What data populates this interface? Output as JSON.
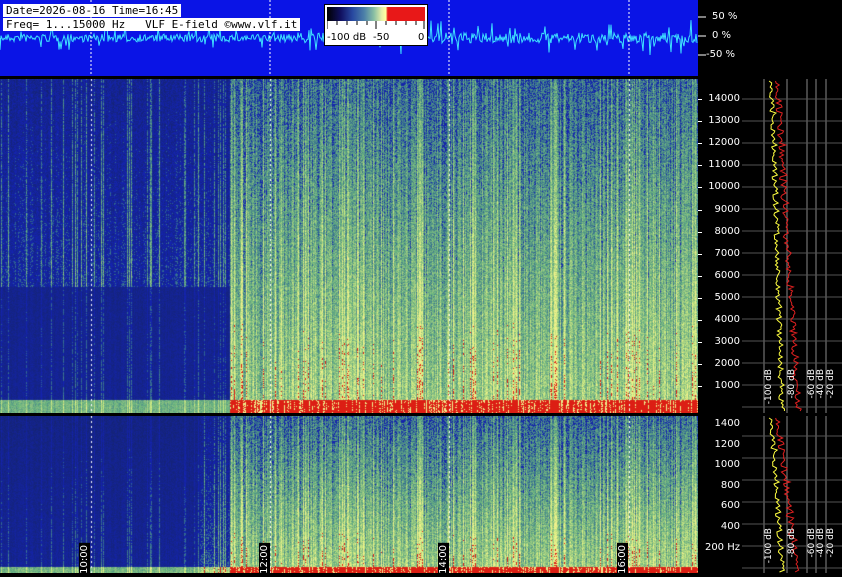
{
  "header": {
    "line1": "Date=2026-08-16 Time=16:45",
    "line2": "Freq= 1...15000 Hz   VLF E-field ©www.vlf.it"
  },
  "colorbar": {
    "labels": [
      "-100 dB",
      "-50",
      "0"
    ]
  },
  "waveform_scale": [
    "50 %",
    "0 %",
    "-50 %"
  ],
  "upper_freq_labels": [
    "14000",
    "13000",
    "12000",
    "11000",
    "10000",
    "9000",
    "8000",
    "7000",
    "6000",
    "5000",
    "4000",
    "3000",
    "2000",
    "1000"
  ],
  "lower_freq_labels": [
    "1400",
    "1200",
    "1000",
    "800",
    "600",
    "400",
    "200 Hz"
  ],
  "time_labels": [
    "10:00",
    "12:00",
    "14:00",
    "16:00"
  ],
  "upper_db_labels": [
    "-100 dB",
    "-80 dB",
    "-60 dB",
    "-40 dB",
    "-20 dB"
  ],
  "lower_db_labels": [
    "-100 dB",
    "-80 dB",
    "-60 dB",
    "-40 dB",
    "-20 dB"
  ],
  "colors": {
    "strip_blue": "#0a14e6",
    "waveform": "#3ee0ff",
    "spectrum_trace": "#ffff40",
    "peak_trace": "#e02020",
    "green_trace": "#30d030"
  }
}
